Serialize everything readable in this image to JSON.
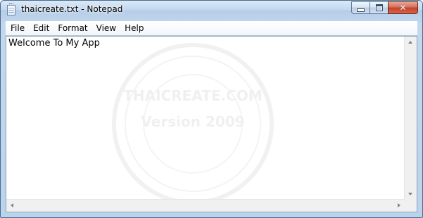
{
  "window": {
    "title": "thaicreate.txt - Notepad",
    "controls": {
      "minimize": "minimize",
      "maximize": "maximize",
      "close": "✕"
    },
    "icons": [
      "notepad-icon",
      "minimize-icon",
      "maximize-icon",
      "close-icon"
    ]
  },
  "menubar": {
    "items": [
      {
        "label": "File"
      },
      {
        "label": "Edit"
      },
      {
        "label": "Format"
      },
      {
        "label": "View"
      },
      {
        "label": "Help"
      }
    ]
  },
  "editor": {
    "content": "Welcome To My App"
  },
  "watermark": {
    "line1": "THAICREATE.COM",
    "line2": "Version 2009"
  },
  "colors": {
    "frame": "#bcd3ec",
    "close_button": "#c4412a",
    "editor_background": "#ffffff",
    "scrollbar": "#f0f0f0"
  }
}
